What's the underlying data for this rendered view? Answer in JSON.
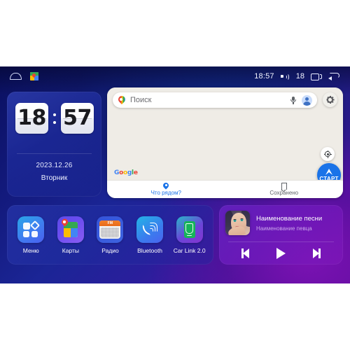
{
  "statusbar": {
    "home_icon": "home-icon",
    "maps_icon": "google-maps-icon",
    "time": "18:57",
    "volume_icon": "volume-icon",
    "volume_level": "18",
    "recents_icon": "recents-icon",
    "back_icon": "back-icon"
  },
  "clock_widget": {
    "hours": "18",
    "minutes": "57",
    "date": "2023.12.26",
    "weekday": "Вторник"
  },
  "map_widget": {
    "search_placeholder": "Поиск",
    "pin_icon": "map-pin-icon",
    "mic_icon": "microphone-icon",
    "avatar_icon": "account-avatar-icon",
    "settings_icon": "gear-icon",
    "locate_icon": "my-location-icon",
    "start_label": "СТАРТ",
    "brand": "Google",
    "brand_letters": [
      "G",
      "o",
      "o",
      "g",
      "l",
      "e"
    ],
    "tabs": [
      {
        "label": "Что рядом?",
        "icon": "location-pin-icon",
        "active": true
      },
      {
        "label": "Сохранено",
        "icon": "bookmark-icon",
        "active": false
      }
    ]
  },
  "dock": {
    "apps": [
      {
        "label": "Меню",
        "icon": "apps-grid-icon"
      },
      {
        "label": "Карты",
        "icon": "google-maps-icon"
      },
      {
        "label": "Радио",
        "icon": "fm-radio-icon",
        "band": "FM"
      },
      {
        "label": "Bluetooth",
        "icon": "bluetooth-phone-icon"
      },
      {
        "label": "Car Link 2.0",
        "icon": "car-link-icon"
      }
    ]
  },
  "player": {
    "album_art": "album-art-woman-illustration",
    "track_title": "Наименование песни",
    "track_artist": "Наименование певца",
    "controls": [
      {
        "name": "previous",
        "icon": "skip-previous-icon"
      },
      {
        "name": "play",
        "icon": "play-icon"
      },
      {
        "name": "next",
        "icon": "skip-next-icon"
      }
    ]
  },
  "colors": {
    "accent_blue": "#1a73e8",
    "bg_blue": "#131a7d",
    "bg_purple": "#6a10ad",
    "map_bg": "#efece6",
    "artist_text": "#c9a6ea"
  }
}
